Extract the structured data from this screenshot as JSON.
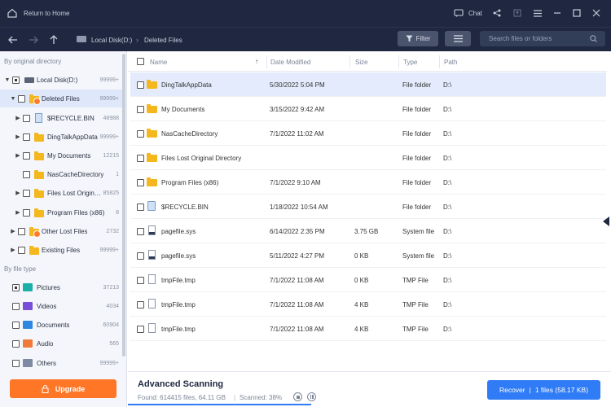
{
  "topbar": {
    "home_label": "Return to Home",
    "chat_label": "Chat"
  },
  "navbar": {
    "breadcrumb_disk": "Local Disk(D:)",
    "breadcrumb_sep": "›",
    "breadcrumb_folder": "Deleted Files",
    "filter_label": "Filter",
    "search_placeholder": "Search files or folders"
  },
  "sidebar": {
    "by_dir_label": "By original directory",
    "tree": [
      {
        "label": "Local Disk(D:)",
        "count": "99999+"
      },
      {
        "label": "Deleted Files",
        "count": "99999+"
      },
      {
        "label": "$RECYCLE.BIN",
        "count": "48988"
      },
      {
        "label": "DingTalkAppData",
        "count": "99999+"
      },
      {
        "label": "My Documents",
        "count": "12215"
      },
      {
        "label": "NasCacheDirectory",
        "count": "1"
      },
      {
        "label": "Files Lost Origina...",
        "count": "85825"
      },
      {
        "label": "Program Files (x86)",
        "count": "8"
      },
      {
        "label": "Other Lost Files",
        "count": "2732"
      },
      {
        "label": "Existing Files",
        "count": "99999+"
      }
    ],
    "by_type_label": "By file type",
    "types": [
      {
        "label": "Pictures",
        "count": "37213"
      },
      {
        "label": "Videos",
        "count": "4034"
      },
      {
        "label": "Documents",
        "count": "60904"
      },
      {
        "label": "Audio",
        "count": "565"
      },
      {
        "label": "Others",
        "count": "99999+"
      }
    ],
    "upgrade_label": "Upgrade"
  },
  "table": {
    "headers": {
      "name": "Name",
      "date": "Date Modified",
      "size": "Size",
      "type": "Type",
      "path": "Path"
    },
    "rows": [
      {
        "name": "DingTalkAppData",
        "date": "5/30/2022 5:04 PM",
        "size": "",
        "type": "File folder",
        "path": "D:\\"
      },
      {
        "name": "My Documents",
        "date": "3/15/2022 9:42 AM",
        "size": "",
        "type": "File folder",
        "path": "D:\\"
      },
      {
        "name": "NasCacheDirectory",
        "date": "7/1/2022 11:02 AM",
        "size": "",
        "type": "File folder",
        "path": "D:\\"
      },
      {
        "name": "Files Lost Original Directory",
        "date": "",
        "size": "",
        "type": "File folder",
        "path": "D:\\"
      },
      {
        "name": "Program Files (x86)",
        "date": "7/1/2022 9:10 AM",
        "size": "",
        "type": "File folder",
        "path": "D:\\"
      },
      {
        "name": "$RECYCLE.BIN",
        "date": "1/18/2022 10:54 AM",
        "size": "",
        "type": "File folder",
        "path": "D:\\"
      },
      {
        "name": "pagefile.sys",
        "date": "6/14/2022 2:35 PM",
        "size": "3.75 GB",
        "type": "System file",
        "path": "D:\\"
      },
      {
        "name": "pagefile.sys",
        "date": "5/11/2022 4:27 PM",
        "size": "0 KB",
        "type": "System file",
        "path": "D:\\"
      },
      {
        "name": "tmpFile.tmp",
        "date": "7/1/2022 11:08 AM",
        "size": "0 KB",
        "type": "TMP File",
        "path": "D:\\"
      },
      {
        "name": "tmpFile.tmp",
        "date": "7/1/2022 11:08 AM",
        "size": "4 KB",
        "type": "TMP File",
        "path": "D:\\"
      },
      {
        "name": "tmpFile.tmp",
        "date": "7/1/2022 11:08 AM",
        "size": "4 KB",
        "type": "TMP File",
        "path": "D:\\"
      }
    ]
  },
  "bottom": {
    "title": "Advanced Scanning",
    "found_text": "Found: 614415 files, 64.11 GB",
    "sep_text": "|",
    "scanned_text": "Scanned: 38%",
    "recover_label": "Recover",
    "recover_sep": "|",
    "recover_info": "1 files (58.17 KB)",
    "progress": 0.38
  },
  "colors": {
    "header": "#1f2840",
    "accent": "#2f7cf6",
    "upgrade": "#ff7626",
    "folder": "#f4b71d"
  }
}
